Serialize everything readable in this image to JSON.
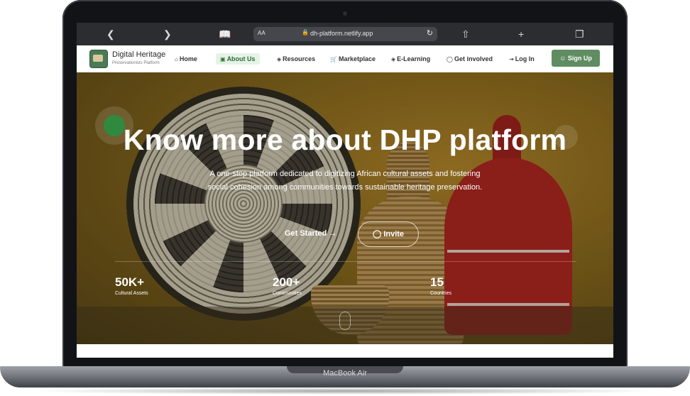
{
  "device": {
    "label": "MacBook Air"
  },
  "browser": {
    "back_icon": "chevron-left-icon",
    "forward_icon": "chevron-right-icon",
    "reader_icon": "book-icon",
    "text_size": "AA",
    "url": "dh-platform.netlify.app",
    "share_icon": "share-icon",
    "new_tab_icon": "plus-icon",
    "tabs_icon": "tabs-icon"
  },
  "header": {
    "brand_title": "Digital Heritage",
    "brand_subtitle": "Preservationists Platform",
    "nav": [
      {
        "label": "Home",
        "icon": "home-icon"
      },
      {
        "label": "About Us",
        "icon": "book-icon",
        "active": true
      },
      {
        "label": "Resources",
        "icon": "layers-icon"
      },
      {
        "label": "Marketplace",
        "icon": "cart-icon"
      },
      {
        "label": "E-Learning",
        "icon": "graduation-icon"
      },
      {
        "label": "Get involved",
        "icon": "user-icon"
      },
      {
        "label": "Log In",
        "icon": "login-icon"
      }
    ],
    "signup_label": "Sign Up",
    "accent_color": "#5e8d62"
  },
  "hero": {
    "title": "Know more about DHP platform",
    "description": "A one-stop platform dedicated to digitizing African cultural assets and fostering social cohesion among communities towards sustainable heritage preservation.",
    "cta_primary": "Get Started",
    "cta_secondary": "Invite",
    "stats": [
      {
        "value": "50K+",
        "label": "Cultural Assets"
      },
      {
        "value": "200+",
        "label": "Communities"
      },
      {
        "value": "15",
        "label": "Countries"
      }
    ]
  }
}
